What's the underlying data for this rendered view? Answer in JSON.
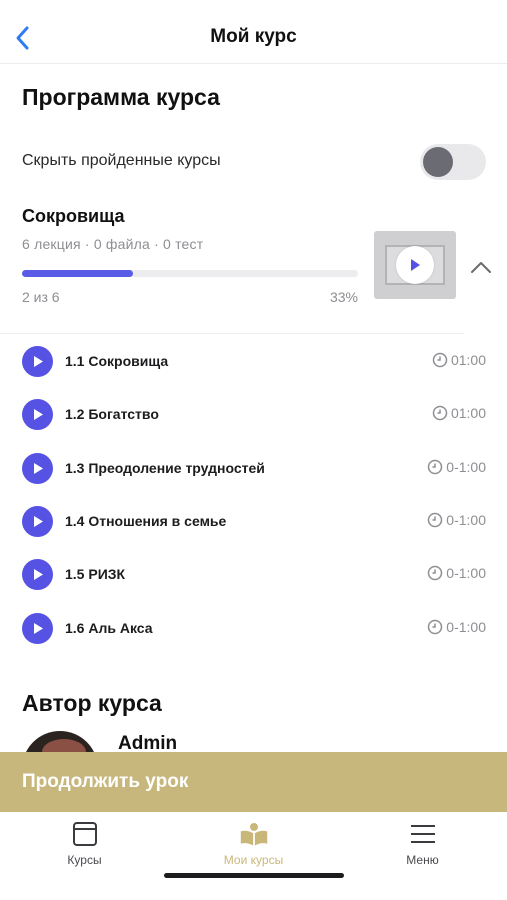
{
  "header": {
    "title": "Мой курс"
  },
  "program": {
    "title": "Программа курса",
    "hide_completed_label": "Скрыть пройденные курсы",
    "hide_completed_on": false
  },
  "course": {
    "name": "Сокровища",
    "meta": "6 лекция · 0 файла · 0 тест",
    "progress_fraction": 0.33,
    "progress_count": "2 из 6",
    "progress_percent": "33%"
  },
  "lessons": [
    {
      "title": "1.1 Сокровища",
      "duration": "01:00"
    },
    {
      "title": "1.2 Богатство",
      "duration": "01:00"
    },
    {
      "title": "1.3 Преодоление трудностей",
      "duration": "0-1:00"
    },
    {
      "title": "1.4 Отношения в семье",
      "duration": "0-1:00"
    },
    {
      "title": "1.5 РИЗК",
      "duration": "0-1:00"
    },
    {
      "title": "1.6 Аль Акса",
      "duration": "0-1:00"
    }
  ],
  "author": {
    "title": "Автор курса",
    "name": "Admin"
  },
  "continue_button": {
    "label": "Продолжить урок"
  },
  "tabs": [
    {
      "label": "Курсы",
      "icon": "courses-icon",
      "active": false
    },
    {
      "label": "Мои курсы",
      "icon": "open-book-icon",
      "active": true
    },
    {
      "label": "Меню",
      "icon": "menu-icon",
      "active": false
    }
  ],
  "colors": {
    "accent": "#5552e4",
    "gold": "#c7b77c",
    "back_arrow": "#2f7bf5"
  }
}
